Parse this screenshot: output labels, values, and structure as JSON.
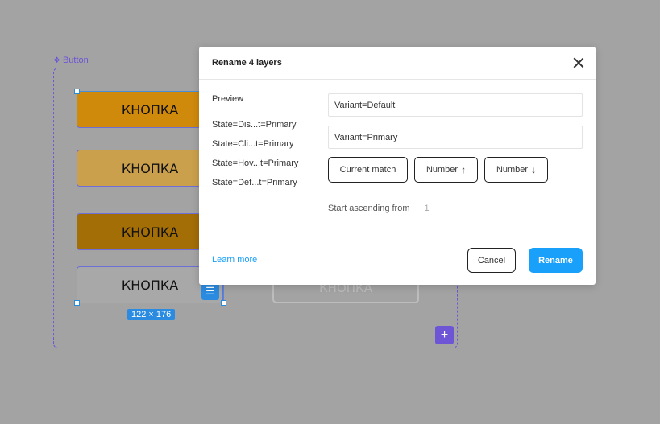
{
  "canvas": {
    "component_name": "Button",
    "component_icon": "component-diamond-icon",
    "variants": [
      {
        "label": "КНОПКА",
        "color": "#cf8a0c"
      },
      {
        "label": "КНОПКА",
        "color": "#caa04c"
      },
      {
        "label": "КНОПКА",
        "color": "#a46e07"
      },
      {
        "label": "КНОПКА",
        "color": "#a8a8a8"
      }
    ],
    "ghost_label": "КНОПКА",
    "selection_size": "122 × 176",
    "add_variant_symbol": "+"
  },
  "modal": {
    "title": "Rename 4 layers",
    "preview_label": "Preview",
    "preview_items": [
      "State=Dis...t=Primary",
      "State=Cli...t=Primary",
      "State=Hov...t=Primary",
      "State=Def...t=Primary"
    ],
    "match_value": "Variant=Default",
    "replace_value": "Variant=Primary",
    "tokens": {
      "current_match": "Current match",
      "number_asc": "Number",
      "number_desc": "Number"
    },
    "start_label": "Start ascending from",
    "start_value": "1",
    "learn_more": "Learn more",
    "cancel": "Cancel",
    "rename": "Rename"
  },
  "colors": {
    "accent": "#18a0fb",
    "component_purple": "#6d55d6",
    "selection_blue": "#2a8be0"
  }
}
